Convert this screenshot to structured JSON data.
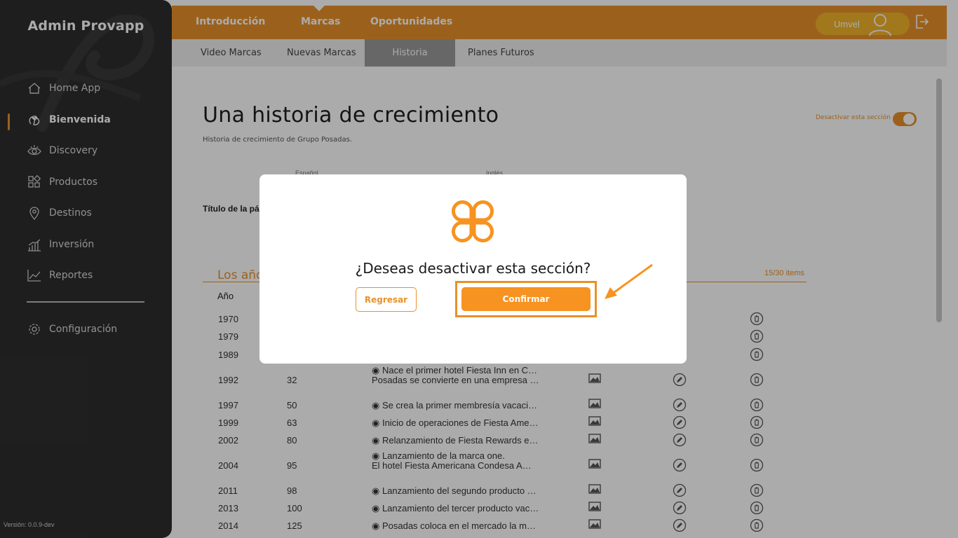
{
  "sidebar": {
    "title": "Admin Provapp",
    "items": [
      {
        "label": "Home App",
        "icon": "home-icon"
      },
      {
        "label": "Bienvenida",
        "icon": "wave-hand-icon"
      },
      {
        "label": "Discovery",
        "icon": "eye-icon"
      },
      {
        "label": "Productos",
        "icon": "grid-icon"
      },
      {
        "label": "Destinos",
        "icon": "location-pin-icon"
      },
      {
        "label": "Inversión",
        "icon": "bar-chart-icon"
      },
      {
        "label": "Reportes",
        "icon": "line-chart-icon"
      }
    ],
    "settings": {
      "label": "Configuración",
      "icon": "gear-icon"
    },
    "active": "Bienvenida",
    "version": "Versión: 0.0.9-dev"
  },
  "topbar": {
    "tabs": [
      "Introducción",
      "Marcas",
      "Oportunidades"
    ],
    "active_tab": "Marcas",
    "user_name": "Umvel"
  },
  "subnav": {
    "tabs": [
      "Video Marcas",
      "Nuevas Marcas",
      "Historia",
      "Planes Futuros"
    ],
    "active_tab": "Historia"
  },
  "page": {
    "title": "Una historia de crecimiento",
    "subtitle": "Historia de crecimiento de Grupo Posadas.",
    "toggle_label": "Desactivar esta sección",
    "toggle_on": true,
    "lang_es": "Español",
    "lang_en": "Inglés",
    "field_label": "Título de la página",
    "section_title": "Los años",
    "section_count": "15/30 items",
    "col_year": "Año"
  },
  "rows": [
    {
      "year": "1970",
      "num": "",
      "desc": ""
    },
    {
      "year": "1979",
      "num": "",
      "desc": ""
    },
    {
      "year": "1989",
      "num": "",
      "desc": ""
    },
    {
      "year": "1992",
      "num": "32",
      "desc": "Posadas se convierte en una empresa …"
    },
    {
      "year": "1997",
      "num": "50",
      "desc": "◉ Se crea la primer membresía vacacio…"
    },
    {
      "year": "1999",
      "num": "63",
      "desc": "◉ Inicio de operaciones de Fiesta Ame…"
    },
    {
      "year": "2002",
      "num": "80",
      "desc": "◉ Relanzamiento de Fiesta Rewards e…"
    },
    {
      "year": "2004",
      "num": "95",
      "desc": "El hotel Fiesta Americana Condesa A…"
    },
    {
      "year": "2011",
      "num": "98",
      "desc": "◉ Lanzamiento del segundo producto v…"
    },
    {
      "year": "2013",
      "num": "100",
      "desc": "◉ Lanzamiento del tercer producto vac…"
    },
    {
      "year": "2014",
      "num": "125",
      "desc": "◉ Posadas coloca en el mercado la ma…"
    }
  ],
  "extra_lines": {
    "line_1992_top": "◉ Nace el primer hotel Fiesta Inn en C…",
    "line_2004_top": "◉ Lanzamiento de la marca one."
  },
  "modal": {
    "question": "¿Deseas desactivar esta sección?",
    "back_label": "Regresar",
    "confirm_label": "Confirmar",
    "logo_icon": "clover-logo-icon"
  },
  "colors": {
    "accent": "#e8912a",
    "confirm": "#f79320",
    "sidebar_bg": "#2e2e2e"
  }
}
